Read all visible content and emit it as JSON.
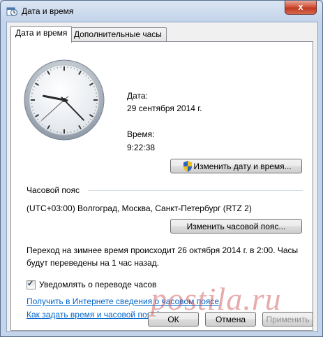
{
  "window": {
    "title": "Дата и время",
    "close_label": "x"
  },
  "tabs": [
    {
      "label": "Дата и время",
      "active": true
    },
    {
      "label": "Дополнительные часы",
      "active": false
    }
  ],
  "date_section": {
    "date_label": "Дата:",
    "date_value": "29 сентября 2014 г.",
    "time_label": "Время:",
    "time_value": "9:22:38",
    "change_datetime_button": "Изменить дату и время..."
  },
  "clock": {
    "hours": 9,
    "minutes": 22,
    "seconds": 38
  },
  "timezone_section": {
    "header": "Часовой пояс",
    "value": "(UTC+03:00) Волгоград, Москва, Санкт-Петербург (RTZ 2)",
    "change_timezone_button": "Изменить часовой пояс..."
  },
  "dst_notice": {
    "line1": "Переход на зимнее время происходит 26 октября 2014 г. в 2:00. Часы",
    "line2": "будут переведены на 1 час назад."
  },
  "notify_checkbox": {
    "label": "Уведомлять о переводе часов",
    "checked": true
  },
  "links": {
    "online_info": "Получить в Интернете сведения о часовом поясе",
    "how_to": "Как задать время и часовой пояс?"
  },
  "footer": {
    "ok": "ОК",
    "cancel": "Отмена",
    "apply": "Применить"
  },
  "watermark": {
    "text": "postila.ru"
  },
  "colors": {
    "link": "#0066cc",
    "window_frame": "#c4d4ea"
  }
}
